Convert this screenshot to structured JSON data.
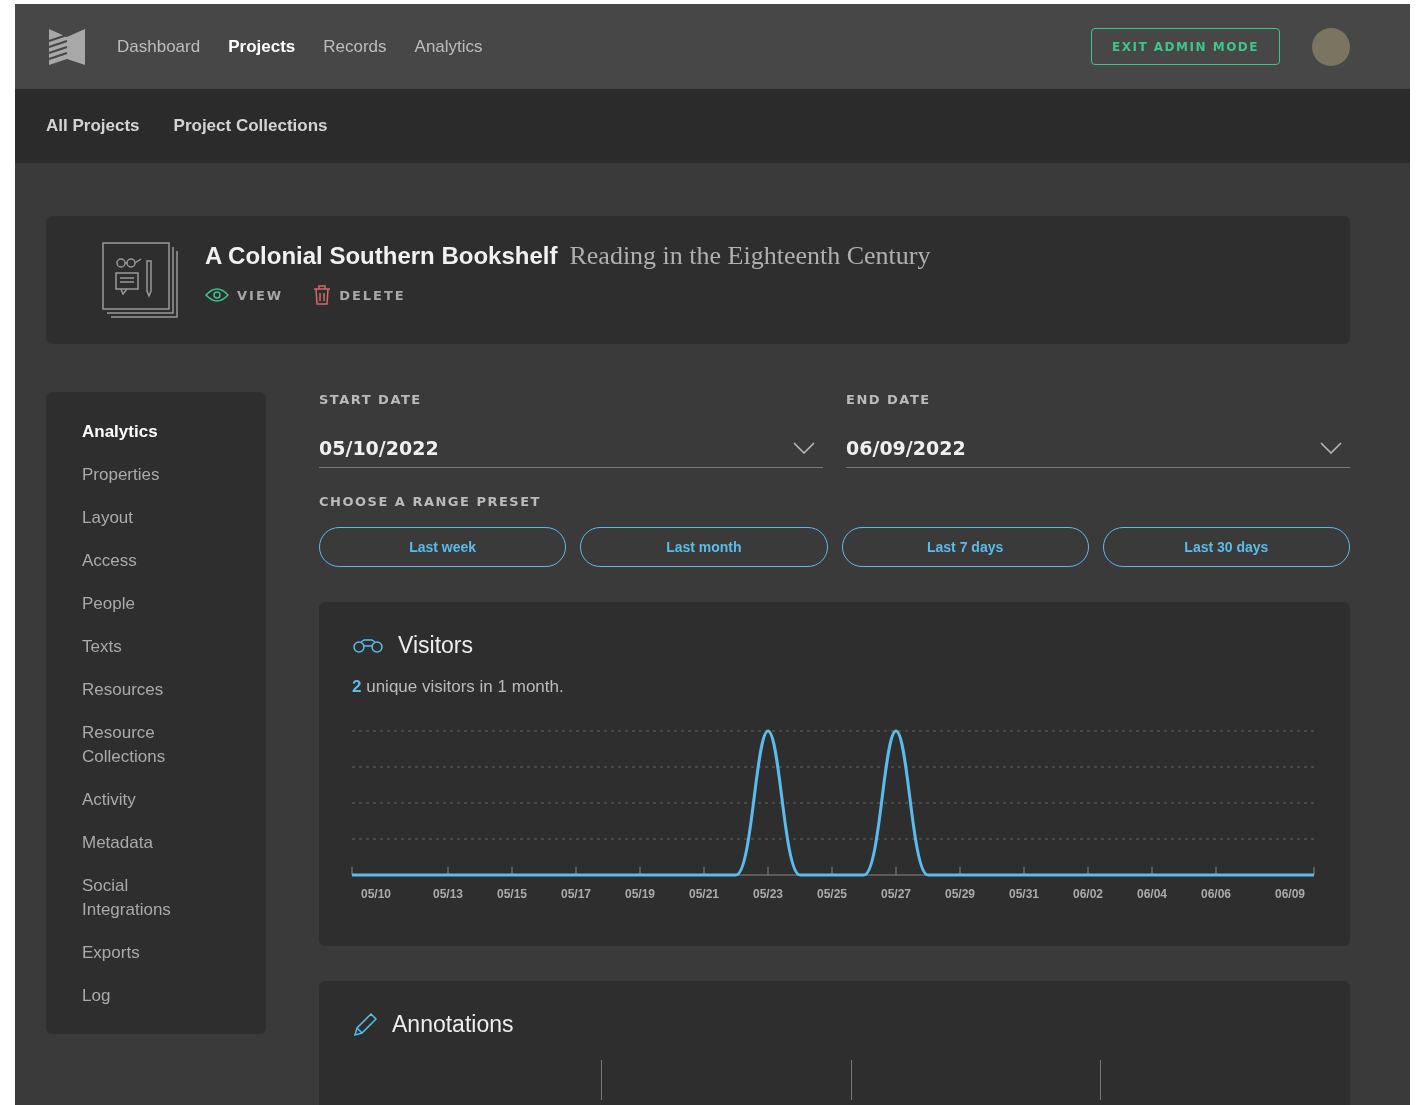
{
  "nav": {
    "items": [
      {
        "label": "Dashboard",
        "selected": false
      },
      {
        "label": "Projects",
        "selected": true
      },
      {
        "label": "Records",
        "selected": false
      },
      {
        "label": "Analytics",
        "selected": false
      }
    ],
    "exit_button": "EXIT ADMIN MODE"
  },
  "subnav": [
    "All Projects",
    "Project Collections"
  ],
  "project": {
    "title": "A Colonial Southern Bookshelf",
    "subtitle": "Reading in the Eighteenth Century",
    "actions": [
      {
        "kind": "view",
        "label": "VIEW"
      },
      {
        "kind": "delete",
        "label": "DELETE"
      }
    ]
  },
  "sidebar": {
    "items": [
      {
        "label": "Analytics",
        "selected": true
      },
      {
        "label": "Properties",
        "selected": false
      },
      {
        "label": "Layout",
        "selected": false
      },
      {
        "label": "Access",
        "selected": false
      },
      {
        "label": "People",
        "selected": false
      },
      {
        "label": "Texts",
        "selected": false
      },
      {
        "label": "Resources",
        "selected": false
      },
      {
        "label": "Resource Collections",
        "selected": false
      },
      {
        "label": "Activity",
        "selected": false
      },
      {
        "label": "Metadata",
        "selected": false
      },
      {
        "label": "Social Integrations",
        "selected": false
      },
      {
        "label": "Exports",
        "selected": false
      },
      {
        "label": "Log",
        "selected": false
      }
    ]
  },
  "dates": [
    {
      "label": "START DATE",
      "value": "05/10/2022"
    },
    {
      "label": "END DATE",
      "value": "06/09/2022"
    }
  ],
  "presets": {
    "label": "CHOOSE A RANGE PRESET",
    "buttons": [
      "Last week",
      "Last month",
      "Last 7 days",
      "Last 30 days"
    ]
  },
  "visitors": {
    "title": "Visitors",
    "summary": "2",
    "summary_rest": "unique visitors in 1 month.",
    "x_labels": [
      "05/10",
      "05/13",
      "05/15",
      "05/17",
      "05/19",
      "05/21",
      "05/23",
      "05/25",
      "05/27",
      "05/29",
      "05/31",
      "06/02",
      "06/04",
      "06/06",
      "06/09"
    ]
  },
  "annotations": {
    "title": "Annotations"
  }
}
